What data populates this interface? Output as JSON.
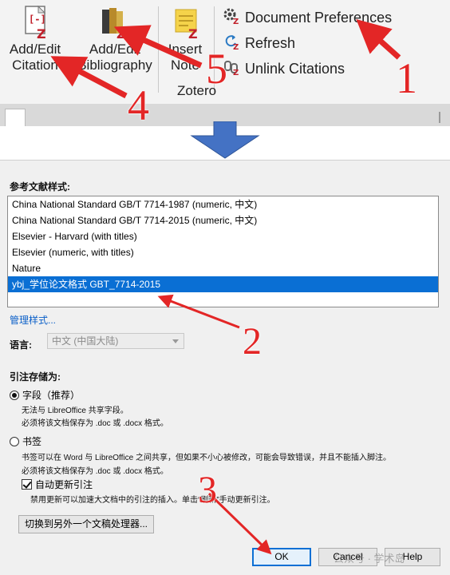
{
  "ribbon": {
    "add_edit_citation": {
      "line1": "Add/Edit",
      "line2": "Citation"
    },
    "add_edit_bibliography": {
      "line1": "Add/Edit",
      "line2": "Bibliography"
    },
    "insert_note": {
      "line1": "Insert",
      "line2": "Note"
    },
    "document_preferences": "Document Preferences",
    "refresh": "Refresh",
    "unlink_citations": "Unlink Citations",
    "group_label": "Zotero"
  },
  "dialog": {
    "citation_style_label": "参考文献样式:",
    "styles": [
      {
        "name": "China National Standard GB/T 7714-1987 (numeric, 中文)",
        "selected": false
      },
      {
        "name": "China National Standard GB/T 7714-2015 (numeric, 中文)",
        "selected": false
      },
      {
        "name": "Elsevier - Harvard (with titles)",
        "selected": false
      },
      {
        "name": "Elsevier (numeric, with titles)",
        "selected": false
      },
      {
        "name": "Nature",
        "selected": false
      },
      {
        "name": "ybj_学位论文格式 GBT_7714-2015",
        "selected": true
      }
    ],
    "manage_styles": "管理样式...",
    "language_label": "语言:",
    "language_value": "中文 (中国大陆)",
    "store_as_label": "引注存储为:",
    "fields_option": "字段（推荐）",
    "fields_desc_1": "无法与 LibreOffice 共享字段。",
    "fields_desc_2": "必须将该文档保存为 .doc 或 .docx 格式。",
    "bookmarks_option": "书签",
    "bookmarks_desc_1": "书签可以在 Word 与 LibreOffice 之间共享，但如果不小心被修改，可能会导致错误，并且不能插入脚注。",
    "bookmarks_desc_2": "必须将该文档保存为 .doc 或 .docx 格式。",
    "auto_update": "自动更新引注",
    "auto_update_desc": "禁用更新可以加速大文档中的引注的插入。单击“刷新”手动更新引注。",
    "switch_processor": "切换到另外一个文稿处理器...",
    "ok": "OK",
    "cancel": "Cancel",
    "help": "Help",
    "watermark": "公众号 · 学术岛"
  },
  "annotations": {
    "n1": "1",
    "n2": "2",
    "n3": "3",
    "n4": "4",
    "n5": "5"
  },
  "colors": {
    "arrow": "#e32626",
    "selection": "#0a6fd4",
    "down_arrow": "#4472c4",
    "zotero_red": "#c0202a"
  }
}
